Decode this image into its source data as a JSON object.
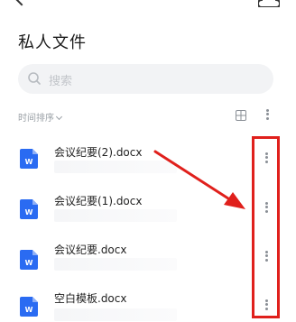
{
  "page": {
    "title": "私人文件"
  },
  "search": {
    "placeholder": "搜索"
  },
  "toolbar": {
    "sort_label": "时间排序"
  },
  "files": [
    {
      "name": "会议纪要(2).docx",
      "icon": "word-file-icon"
    },
    {
      "name": "会议纪要(1).docx",
      "icon": "word-file-icon"
    },
    {
      "name": "会议纪要.docx",
      "icon": "word-file-icon"
    },
    {
      "name": "空白模板.docx",
      "icon": "word-file-icon"
    }
  ],
  "colors": {
    "word_blue": "#2a6bf2",
    "annotation_red": "#e0201c"
  }
}
